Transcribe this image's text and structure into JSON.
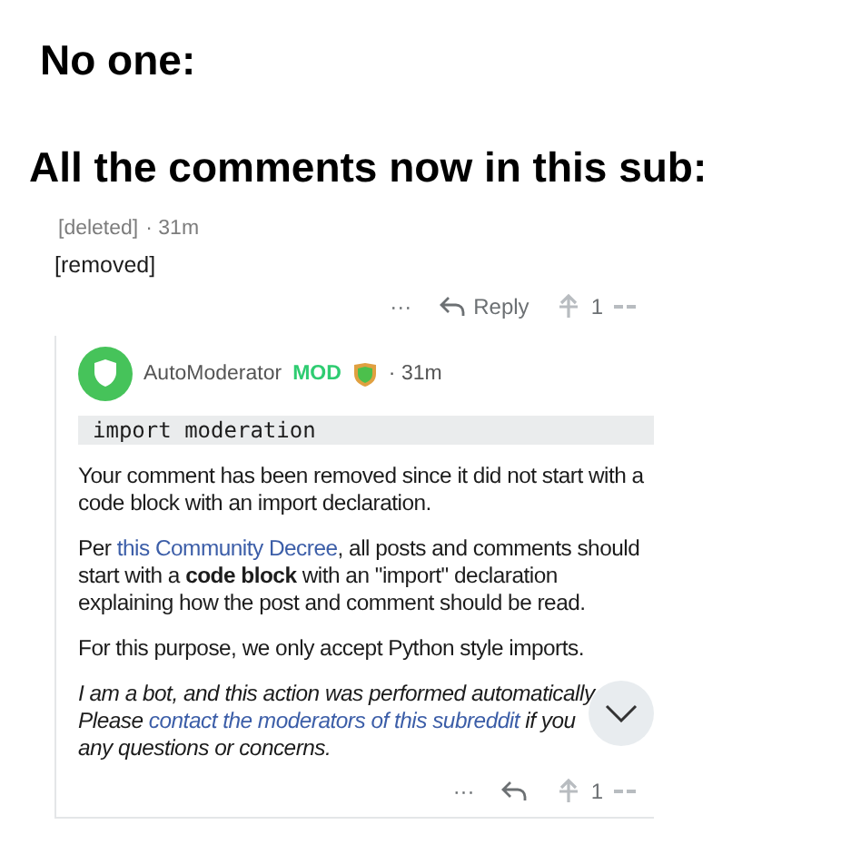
{
  "captions": [
    "No one:",
    "All the comments now in this sub:"
  ],
  "parent_comment": {
    "author": "[deleted]",
    "separator": "·",
    "time": "31m",
    "body": "[removed]",
    "actions": {
      "more": "···",
      "reply": "Reply",
      "score": "1"
    }
  },
  "reply_comment": {
    "author": "AutoModerator",
    "badge": "MOD",
    "separator": "·",
    "time": "31m",
    "code": "import moderation",
    "paragraphs": [
      {
        "kind": "normal",
        "parts": [
          {
            "kind": "text",
            "text": "Your comment has been removed since it did not start with a code block with an import declaration."
          }
        ]
      },
      {
        "kind": "normal",
        "parts": [
          {
            "kind": "text",
            "text": "Per "
          },
          {
            "kind": "link",
            "text": "this Community Decree"
          },
          {
            "kind": "text",
            "text": ", all posts and comments should start with a **code block** with an \"import\" declaration explaining how the post and comment should be read."
          }
        ]
      },
      {
        "kind": "normal",
        "parts": [
          {
            "kind": "text",
            "text": "For this purpose, we only accept Python style imports."
          }
        ]
      },
      {
        "kind": "italic",
        "parts": [
          {
            "kind": "text",
            "text": "I am a bot, and this action was performed automatically"
          },
          {
            "kind": "break"
          },
          {
            "kind": "text",
            "text": "Please "
          },
          {
            "kind": "link",
            "text": "contact the moderators of this subreddit"
          },
          {
            "kind": "text",
            "text": " if you"
          },
          {
            "kind": "break"
          },
          {
            "kind": "text",
            "text": "any questions or concerns."
          }
        ]
      }
    ],
    "actions": {
      "more": "···",
      "score": "1"
    }
  }
}
